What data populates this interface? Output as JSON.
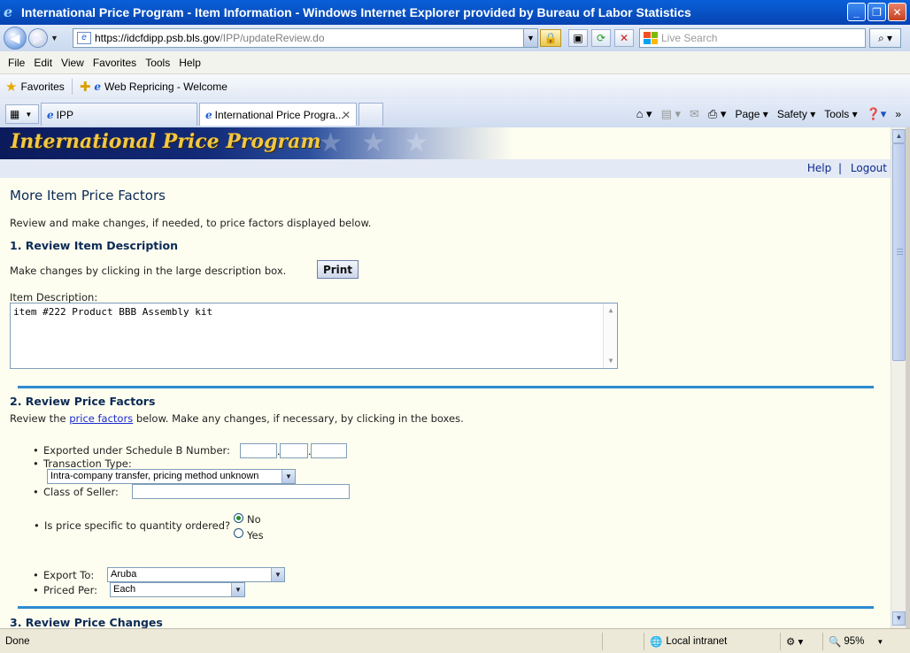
{
  "window": {
    "title": "International Price Program - Item Information - Windows Internet Explorer provided by Bureau of Labor Statistics",
    "minimize": "_",
    "restore": "❐",
    "close": "✕"
  },
  "address": {
    "url_host": "https://idcfdipp.psb.bls.gov",
    "url_path": "/IPP/updateReview.do",
    "search_placeholder": "Live Search"
  },
  "menu": {
    "items": [
      "File",
      "Edit",
      "View",
      "Favorites",
      "Tools",
      "Help"
    ]
  },
  "favorites": {
    "label": "Favorites",
    "link": "Web Repricing - Welcome"
  },
  "tabs": [
    {
      "label": "IPP"
    },
    {
      "label": "International Price Progra..."
    }
  ],
  "command_bar": {
    "page": "Page",
    "safety": "Safety",
    "tools": "Tools"
  },
  "banner": {
    "logo_text": "International Price Program"
  },
  "header_links": {
    "help": "Help",
    "sep": "|",
    "logout": "Logout"
  },
  "page": {
    "title": "More Item Price Factors",
    "intro": "Review and make changes, if needed, to price factors displayed below."
  },
  "section1": {
    "heading": "1. Review Item Description",
    "hint": "Make changes by clicking in the large description box.",
    "print_label": "Print",
    "desc_label": "Item Description:",
    "desc_value": "item #222 Product BBB Assembly kit"
  },
  "section2": {
    "heading": "2. Review Price Factors",
    "intro_pre": "Review the ",
    "intro_link": "price factors",
    "intro_post": " below. Make any changes, if necessary, by clicking in the boxes.",
    "schedule_b_label": "Exported under Schedule B Number:",
    "transaction_label": "Transaction Type:",
    "transaction_value": "Intra-company transfer, pricing method unknown",
    "seller_label": "Class of Seller:",
    "quantity_label": "Is price specific to quantity ordered?",
    "radio_no": "No",
    "radio_yes": "Yes",
    "export_to_label": "Export To:",
    "export_to_value": "Aruba",
    "priced_per_label": "Priced Per:",
    "priced_per_value": "Each"
  },
  "section3": {
    "heading": "3. Review Price Changes"
  },
  "status": {
    "text": "Done",
    "zone": "Local intranet",
    "zoom": "95%"
  }
}
